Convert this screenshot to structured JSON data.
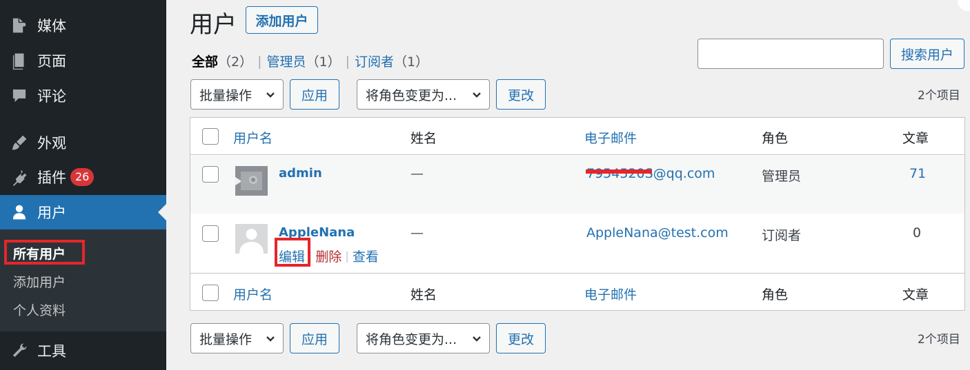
{
  "sidebar": {
    "items": [
      {
        "label": "媒体",
        "icon": "media-icon"
      },
      {
        "label": "页面",
        "icon": "page-icon"
      },
      {
        "label": "评论",
        "icon": "comment-icon"
      },
      {
        "label": "外观",
        "icon": "brush-icon"
      },
      {
        "label": "插件",
        "icon": "plugin-icon",
        "badge": "26"
      },
      {
        "label": "用户",
        "icon": "user-icon"
      },
      {
        "label": "工具",
        "icon": "wrench-icon"
      }
    ],
    "submenu": [
      "所有用户",
      "添加用户",
      "个人资料"
    ]
  },
  "header": {
    "title": "用户",
    "add_button": "添加用户"
  },
  "views": {
    "all": "全部",
    "all_count": "（2）",
    "admin": "管理员",
    "admin_count": "（1）",
    "subscriber": "订阅者",
    "subscriber_count": "（1）",
    "sep": "|"
  },
  "search": {
    "value": "",
    "button": "搜索用户"
  },
  "toolbar": {
    "bulk": "批量操作",
    "apply": "应用",
    "role": "将角色变更为...",
    "change": "更改",
    "count": "2个项目"
  },
  "table": {
    "columns": [
      "用户名",
      "姓名",
      "电子邮件",
      "角色",
      "文章"
    ],
    "rows": [
      {
        "username": "admin",
        "name": "—",
        "email": "7954520S@qq.com",
        "role": "管理员",
        "posts": "71"
      },
      {
        "username": "AppleNana",
        "name": "—",
        "email": "AppleNana@test.com",
        "role": "订阅者",
        "posts": "0",
        "actions": {
          "edit": "编辑",
          "delete": "删除",
          "view": "查看",
          "sep": "|"
        }
      }
    ]
  },
  "colors": {
    "sidebar_bg": "#1d2327",
    "accent": "#2271b1",
    "highlight": "#e5262a",
    "badge": "#d63638",
    "delete": "#b32d2e"
  }
}
